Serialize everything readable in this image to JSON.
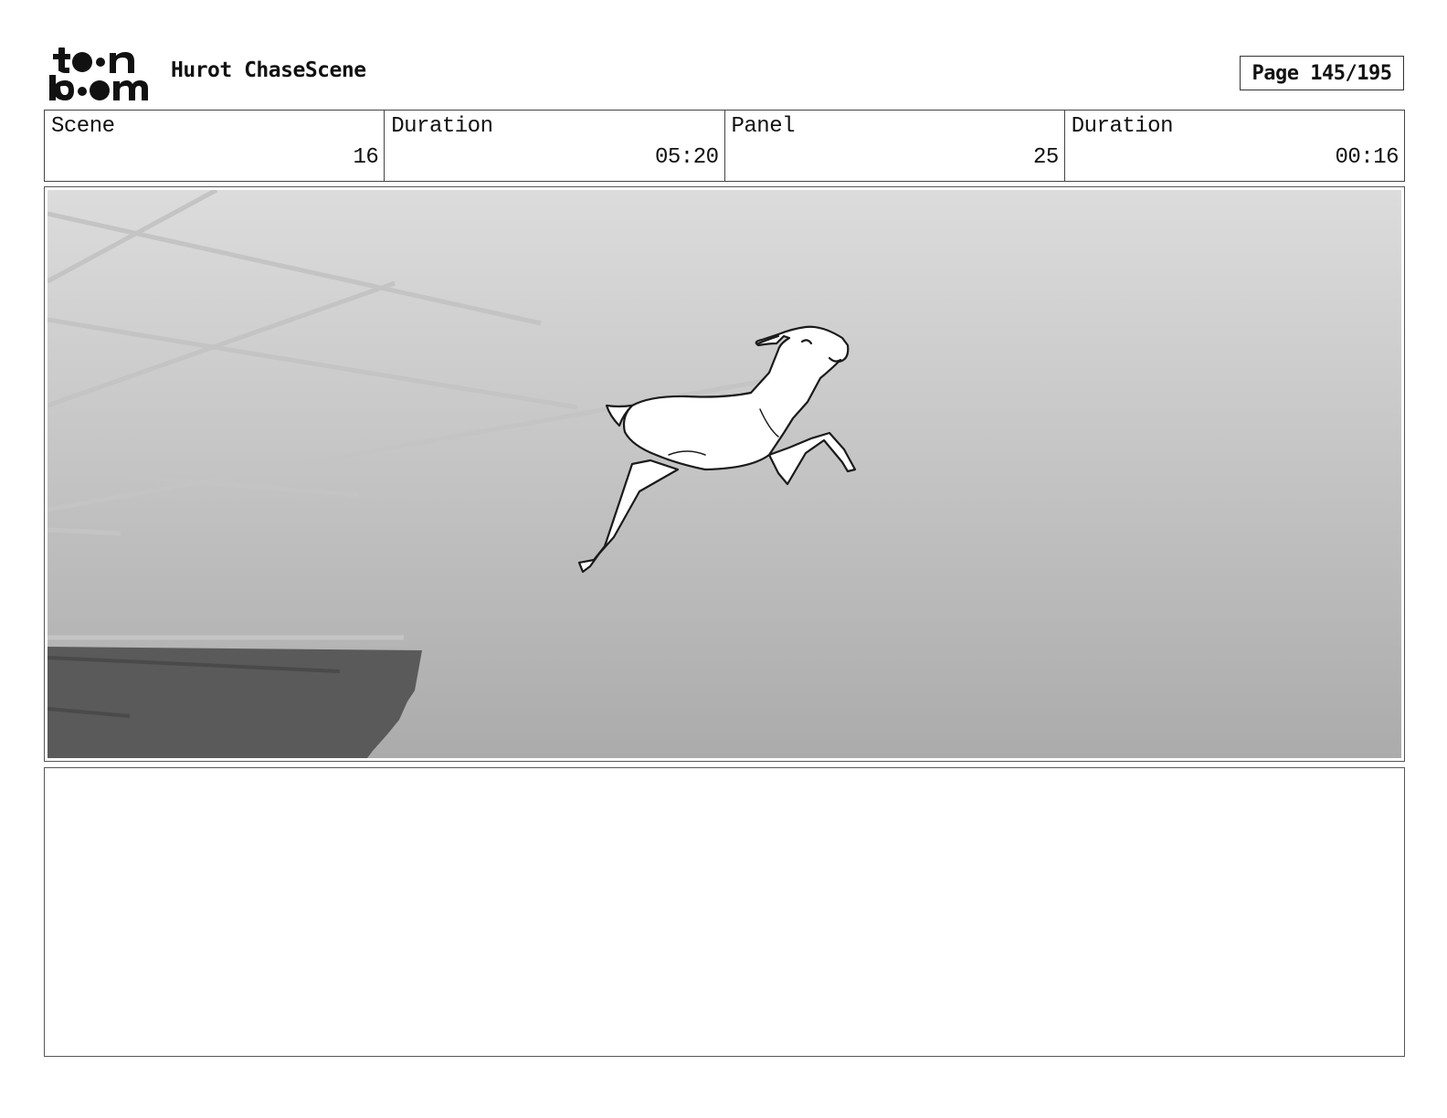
{
  "header": {
    "logo_text": "toon boom",
    "title": "Hurot ChaseScene",
    "page": "Page 145/195"
  },
  "info": [
    {
      "label": "Scene",
      "value": "16"
    },
    {
      "label": "Duration",
      "value": "05:20"
    },
    {
      "label": "Panel",
      "value": "25"
    },
    {
      "label": "Duration",
      "value": "00:16"
    }
  ],
  "panel": {
    "subject": "deer-leaping-from-cliff",
    "background_color_top": "#dcdcdc",
    "background_color_bottom": "#ababab",
    "cliff_color": "#5a5a5a"
  },
  "notes": {
    "text": ""
  }
}
